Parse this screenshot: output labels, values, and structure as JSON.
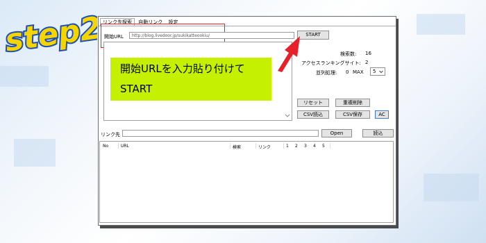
{
  "badge": {
    "text": "step2"
  },
  "tabs": [
    "リンク先探索",
    "自動リンク",
    "設定"
  ],
  "start_url": {
    "label": "開始URL",
    "value": "http://blog.livedoor.jp/sukikatteookiu/"
  },
  "buttons": {
    "start": "START",
    "reset": "リセット",
    "dedupe": "重複削除",
    "csv_load": "CSV読込",
    "csv_save": "CSV保存",
    "ac": "AC",
    "open": "Open",
    "load": "読込"
  },
  "stats": {
    "search_count_label": "検索数:",
    "search_count": "16",
    "access_ranking_label": "アクセスランキングサイト:",
    "access_ranking": "2",
    "parallel_label": "並列処理:",
    "parallel": "0",
    "max_label": "MAX",
    "max_value": "5"
  },
  "callout": {
    "line1": "開始URLを入力貼り付けて",
    "line2": "START"
  },
  "link_dest": {
    "label": "リンク先",
    "value": ""
  },
  "table_headers": [
    "No",
    "URL",
    "検索",
    "リンク",
    "1",
    "2",
    "3",
    "4",
    "5"
  ],
  "colors": {
    "callout_bg": "#c5f000",
    "arrow": "#e8202a",
    "highlight_box": "#e8202a",
    "badge_fill": "#f5d400",
    "badge_outline": "#1e4fb4"
  }
}
